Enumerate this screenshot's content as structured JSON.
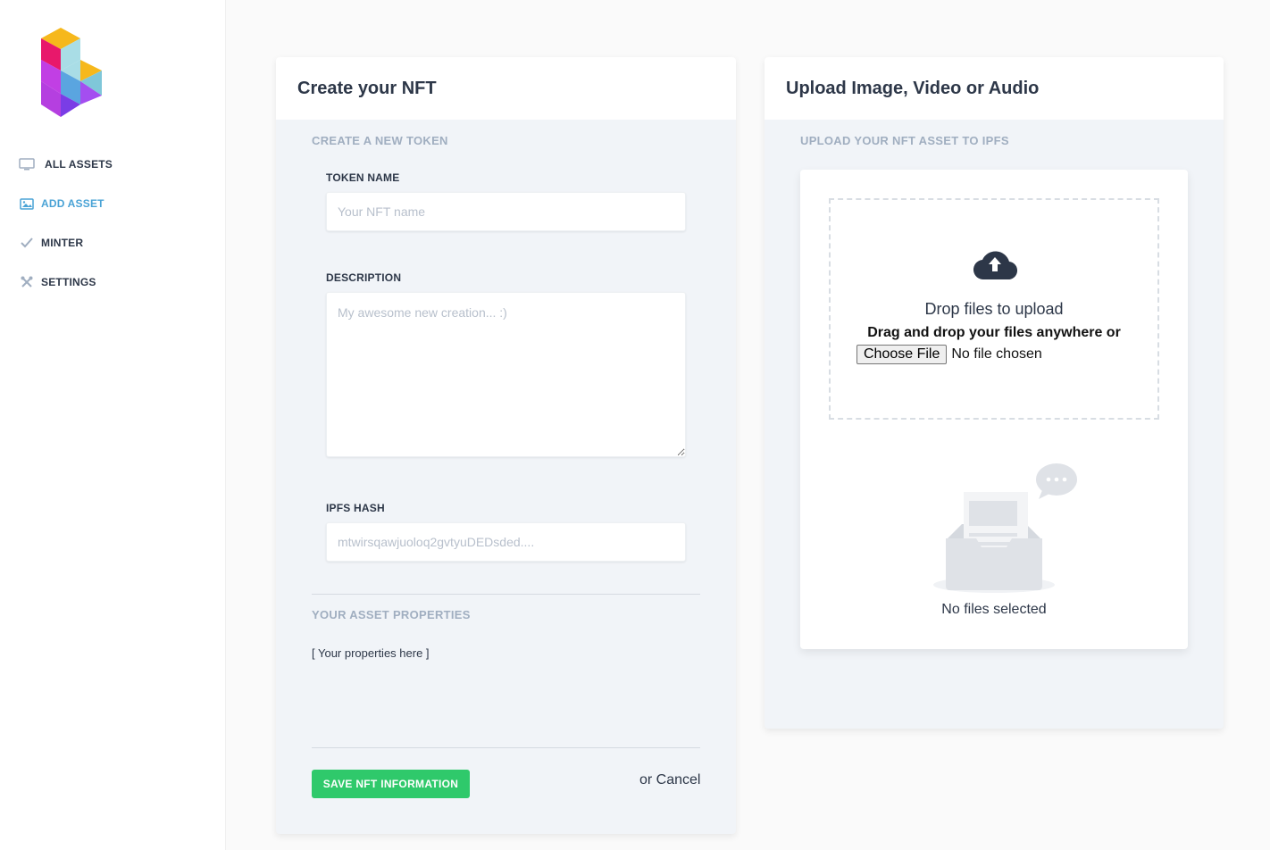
{
  "sidebar": {
    "items": [
      {
        "label": "ALL ASSETS",
        "icon": "monitor-icon",
        "active": false
      },
      {
        "label": "ADD ASSET",
        "icon": "image-icon",
        "active": true
      },
      {
        "label": "MINTER",
        "icon": "check-icon",
        "active": false
      },
      {
        "label": "SETTINGS",
        "icon": "tools-icon",
        "active": false
      }
    ]
  },
  "create": {
    "title": "Create your NFT",
    "section": "CREATE A NEW TOKEN",
    "token_name_label": "TOKEN NAME",
    "token_name_placeholder": "Your NFT name",
    "description_label": "DESCRIPTION",
    "description_placeholder": "My awesome new creation... :)",
    "ipfs_label": "IPFS HASH",
    "ipfs_placeholder": "mtwirsqawjuoloq2gvtyuDEDsded....",
    "properties_title": "YOUR ASSET PROPERTIES",
    "properties_text": "[ Your properties here ]",
    "save_label": "SAVE NFT INFORMATION",
    "cancel_label": "or Cancel"
  },
  "upload": {
    "title": "Upload Image, Video or Audio",
    "section": "UPLOAD YOUR NFT ASSET TO IPFS",
    "drop_title": "Drop files to upload",
    "drop_sub": "Drag and drop your files anywhere or",
    "choose_label": "Choose File",
    "no_file": "No file chosen",
    "empty_label": "No files selected"
  },
  "colors": {
    "accent": "#4aa3d6",
    "save": "#2fc96b"
  }
}
